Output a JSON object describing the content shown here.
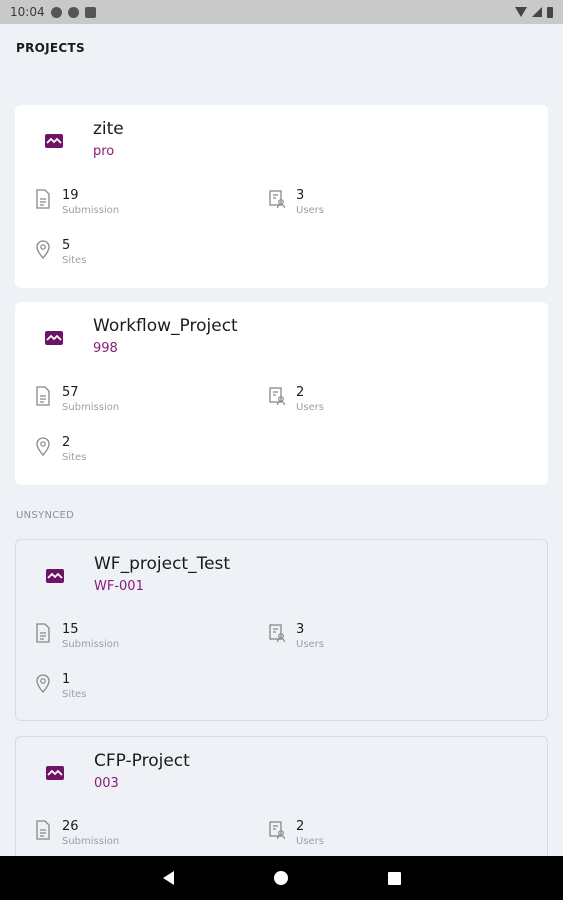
{
  "status_bar": {
    "time": "10:04"
  },
  "sections": {
    "projects": "PROJECTS",
    "unsynced": "UNSYNCED"
  },
  "labels": {
    "submission": "Submission",
    "users": "Users",
    "sites": "Sites"
  },
  "projects": [
    {
      "name": "zite",
      "code": "pro",
      "submissions": "19",
      "users": "3",
      "sites": "5"
    },
    {
      "name": "Workflow_Project",
      "code": "998",
      "submissions": "57",
      "users": "2",
      "sites": "2"
    }
  ],
  "unsynced": [
    {
      "name": "WF_project_Test",
      "code": "WF-001",
      "submissions": "15",
      "users": "3",
      "sites": "1"
    },
    {
      "name": "CFP-Project",
      "code": "003",
      "submissions": "26",
      "users": "2"
    }
  ],
  "colors": {
    "accent": "#6e1366",
    "code_text": "#8a1c7c",
    "background": "#eef1f6"
  },
  "icons": {
    "project": "project-logo-icon",
    "submission": "document-icon",
    "users": "user-list-icon",
    "sites": "location-pin-icon",
    "nav": [
      "back-icon",
      "home-icon",
      "recent-apps-icon"
    ]
  }
}
